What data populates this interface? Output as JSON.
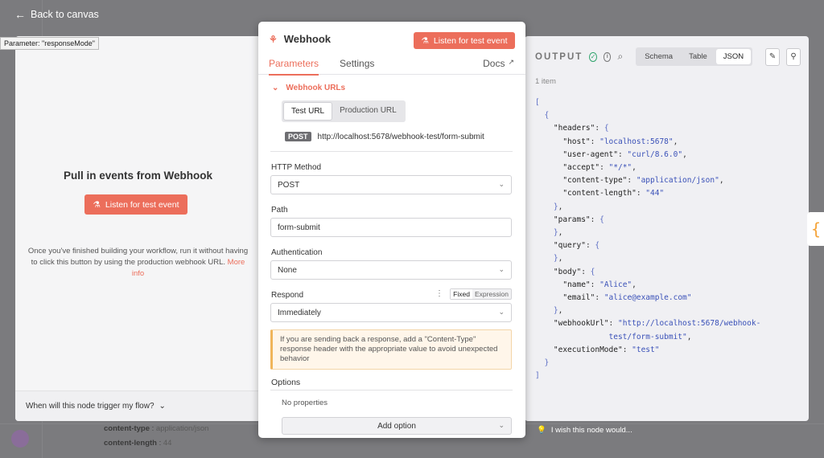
{
  "back_label": "Back to canvas",
  "tooltip": "Parameter: \"responseMode\"",
  "left": {
    "title": "Pull in events from Webhook",
    "listen_label": "Listen for test event",
    "description": "Once you've finished building your workflow, run it without having to click this button by using the production webhook URL.",
    "more_info": "More info",
    "footer": "When will this node trigger my flow?"
  },
  "modal": {
    "title": "Webhook",
    "listen_label": "Listen for test event",
    "tabs": [
      "Parameters",
      "Settings"
    ],
    "docs": "Docs",
    "webhook_urls_label": "Webhook URLs",
    "url_tabs": [
      "Test URL",
      "Production URL"
    ],
    "method_badge": "POST",
    "url": "http://localhost:5678/webhook-test/form-submit",
    "http_method_label": "HTTP Method",
    "http_method_value": "POST",
    "path_label": "Path",
    "path_value": "form-submit",
    "auth_label": "Authentication",
    "auth_value": "None",
    "respond_label": "Respond",
    "respond_modes": [
      "Fixed",
      "Expression"
    ],
    "respond_value": "Immediately",
    "notice": "If you are sending back a response, add a \"Content-Type\" response header with the appropriate value to avoid unexpected behavior",
    "options_label": "Options",
    "no_properties": "No properties",
    "add_option": "Add option"
  },
  "output": {
    "title": "OUTPUT",
    "views": [
      "Schema",
      "Table",
      "JSON"
    ],
    "active_view": "JSON",
    "item_count": "1 item",
    "wish": "I wish this node would..."
  },
  "canvas_bottom": [
    {
      "key": "content-type",
      "value": "application/json"
    },
    {
      "key": "content-length",
      "value": "44"
    }
  ],
  "colors": {
    "accent": "#ec6e5b",
    "success": "#2ea36b",
    "warning": "#f0b55a"
  }
}
